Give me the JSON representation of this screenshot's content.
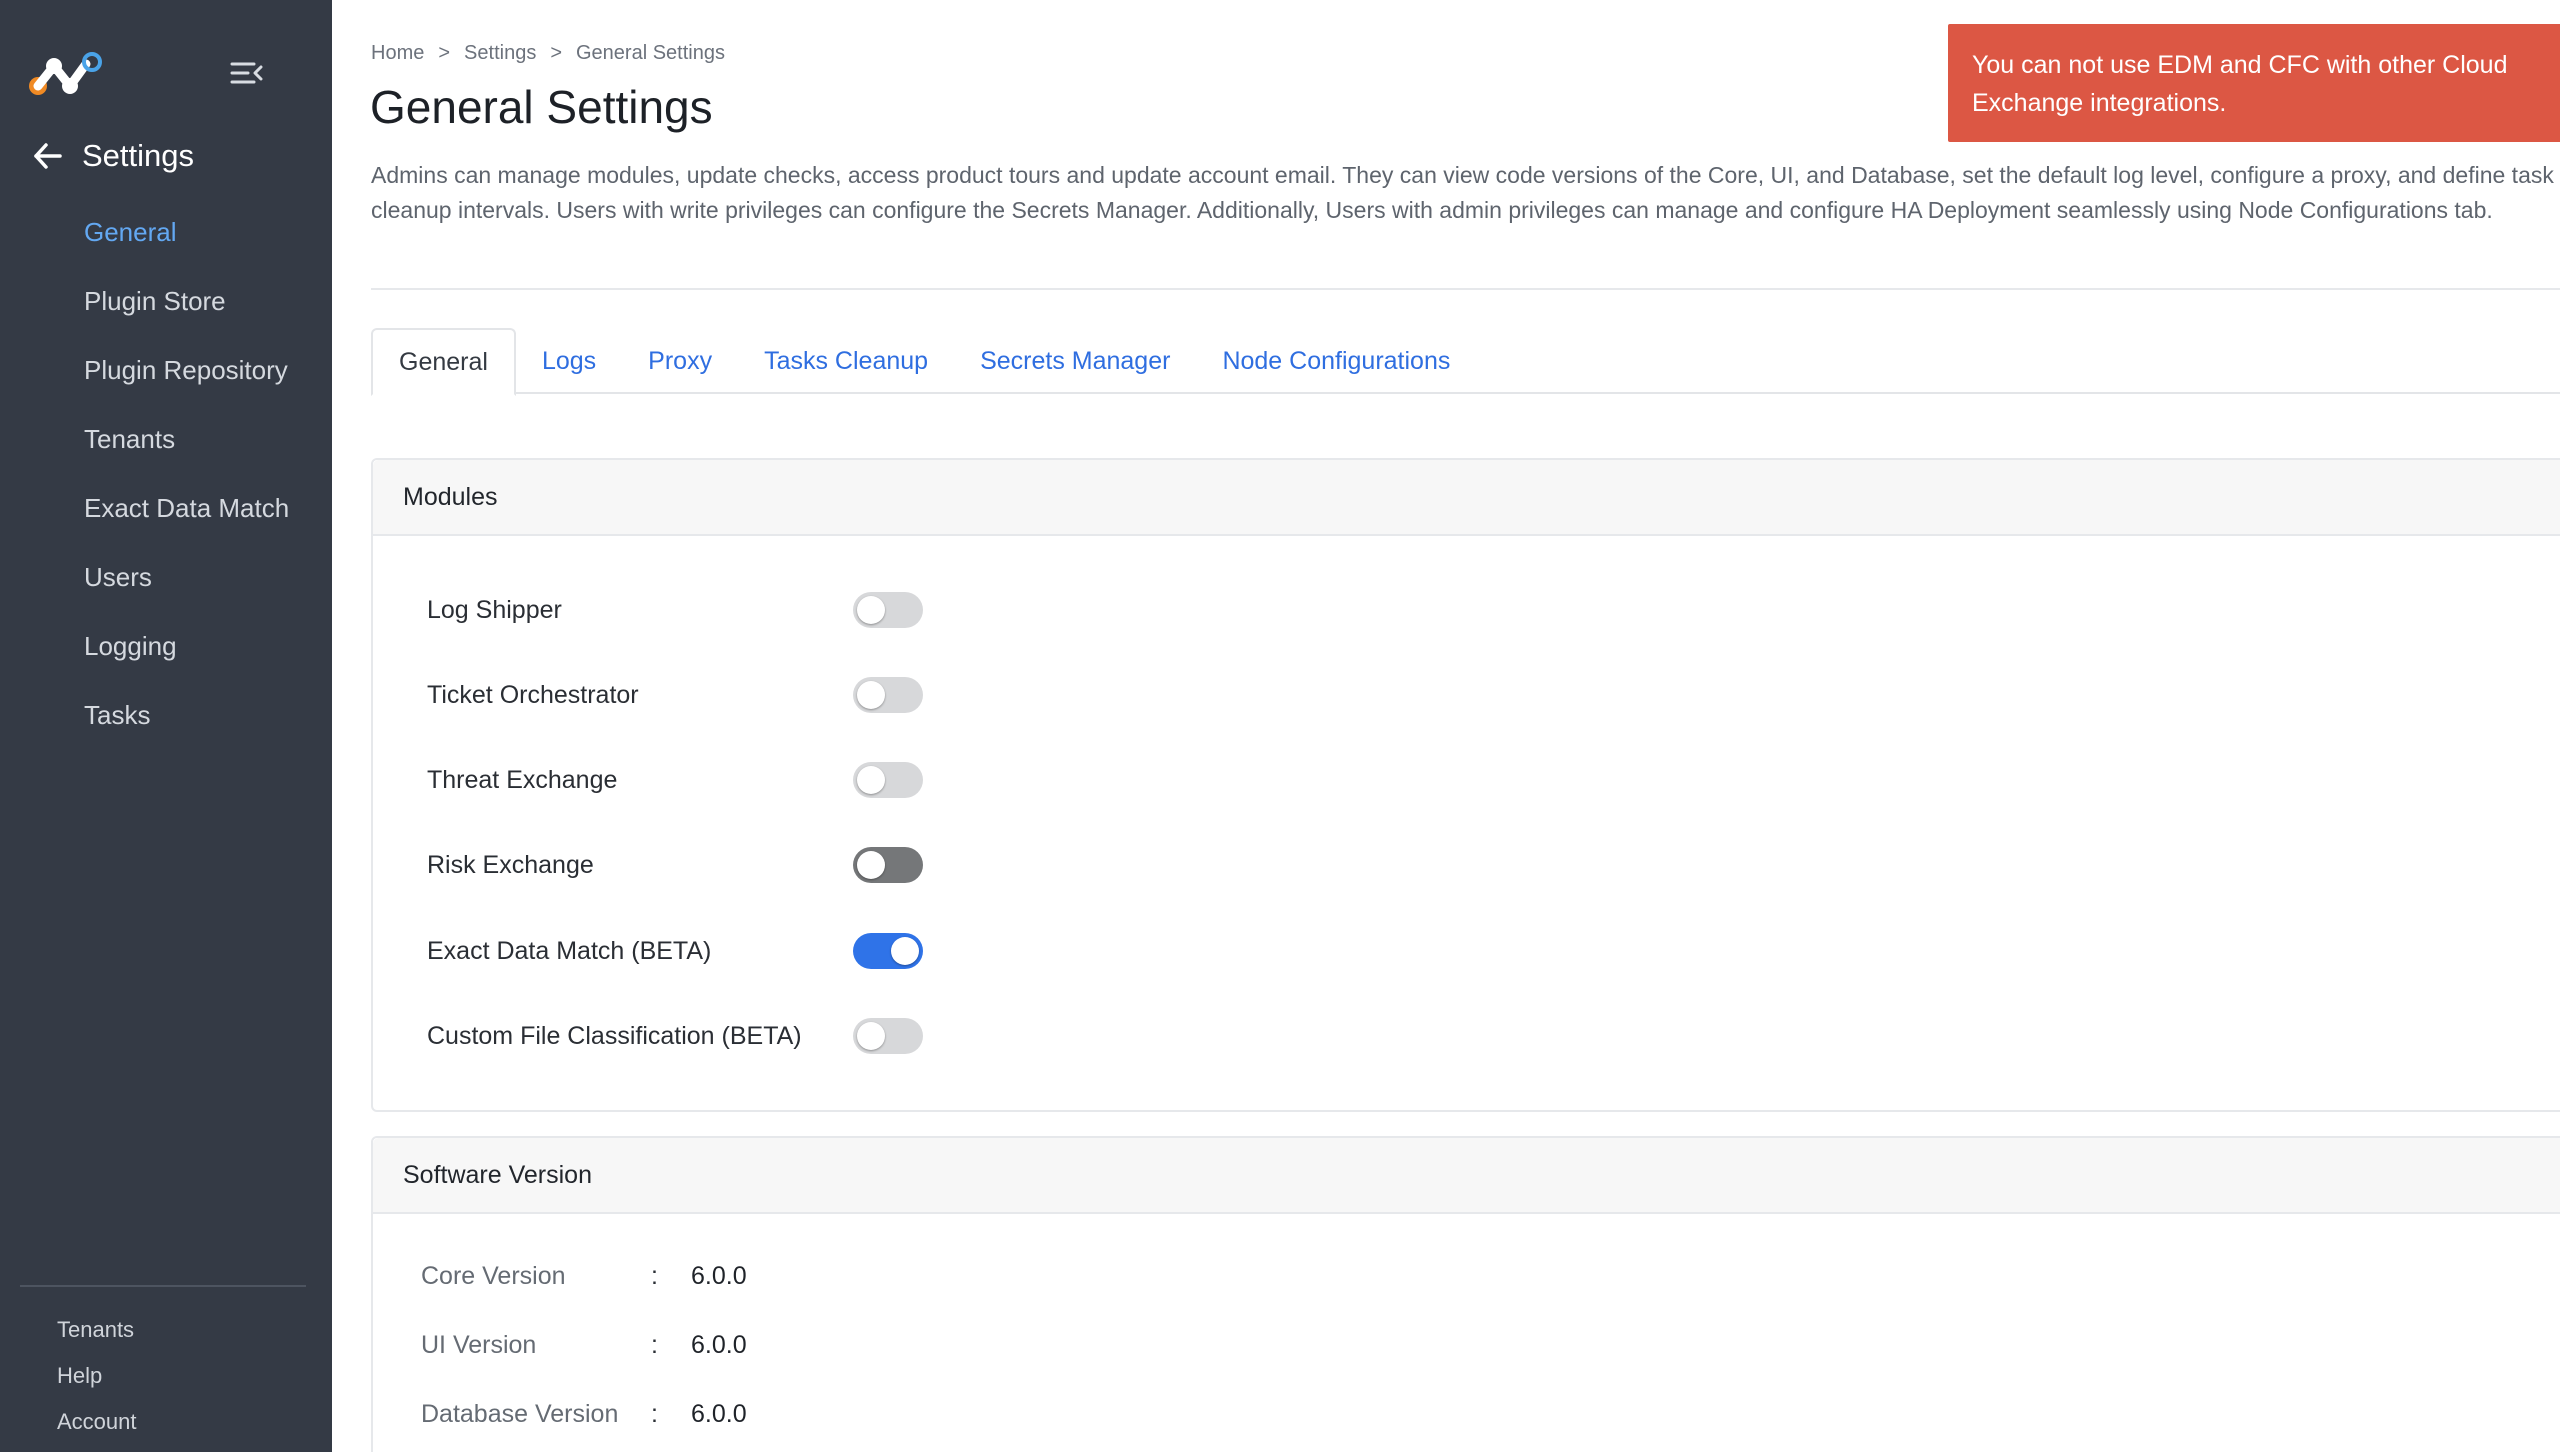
{
  "sidebar": {
    "section_title": "Settings",
    "items": [
      {
        "label": "General",
        "active": true
      },
      {
        "label": "Plugin Store"
      },
      {
        "label": "Plugin Repository"
      },
      {
        "label": "Tenants"
      },
      {
        "label": "Exact Data Match"
      },
      {
        "label": "Users"
      },
      {
        "label": "Logging"
      },
      {
        "label": "Tasks"
      }
    ],
    "footer": [
      {
        "label": "Tenants"
      },
      {
        "label": "Help"
      },
      {
        "label": "Account"
      }
    ]
  },
  "breadcrumb": [
    "Home",
    "Settings",
    "General Settings"
  ],
  "breadcrumb_sep": ">",
  "page": {
    "title": "General Settings",
    "description": "Admins can manage modules, update checks, access product tours and update account email. They can view code versions of the Core, UI, and Database, set the default log level, configure a proxy, and define task cleanup intervals. Users with write privileges can configure the Secrets Manager. Additionally, Users with admin privileges can manage and configure HA Deployment seamlessly using Node Configurations tab."
  },
  "tabs": [
    {
      "label": "General",
      "active": true
    },
    {
      "label": "Logs"
    },
    {
      "label": "Proxy"
    },
    {
      "label": "Tasks Cleanup"
    },
    {
      "label": "Secrets Manager"
    },
    {
      "label": "Node Configurations"
    }
  ],
  "modules": {
    "header": "Modules",
    "items": [
      {
        "label": "Log Shipper",
        "enabled": false
      },
      {
        "label": "Ticket Orchestrator",
        "enabled": false
      },
      {
        "label": "Threat Exchange",
        "enabled": false
      },
      {
        "label": "Risk Exchange",
        "enabled": false
      },
      {
        "label": "Exact Data Match (BETA)",
        "enabled": true
      },
      {
        "label": "Custom File Classification (BETA)",
        "enabled": false
      }
    ]
  },
  "software_version": {
    "header": "Software Version",
    "rows": [
      {
        "label": "Core Version",
        "sep": ":",
        "value": "6.0.0"
      },
      {
        "label": "UI Version",
        "sep": ":",
        "value": "6.0.0"
      },
      {
        "label": "Database Version",
        "sep": ":",
        "value": "6.0.0"
      }
    ]
  },
  "toast": {
    "message": "You can not use EDM and CFC with other Cloud Exchange integrations.",
    "color": "#dc5744"
  },
  "colors": {
    "sidebar_bg": "#343a45",
    "accent": "#2f73e8",
    "active_nav": "#63a8f2"
  }
}
